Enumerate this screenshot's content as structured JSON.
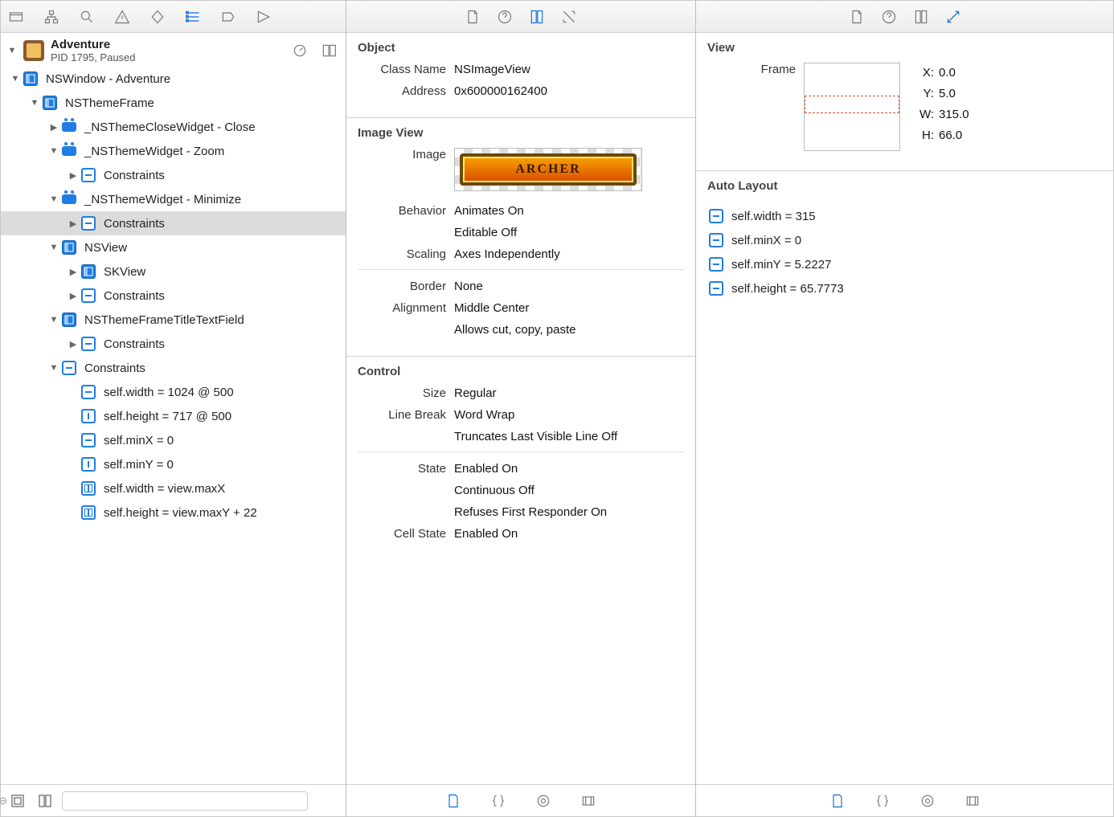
{
  "process": {
    "name": "Adventure",
    "subtitle": "PID 1795, Paused"
  },
  "tree": [
    {
      "indent": 0,
      "tri": "▼",
      "icon": "window",
      "label": "NSWindow - Adventure"
    },
    {
      "indent": 1,
      "tri": "▼",
      "icon": "view",
      "label": "NSThemeFrame"
    },
    {
      "indent": 2,
      "tri": "▶",
      "icon": "widget",
      "label": "_NSThemeCloseWidget - Close"
    },
    {
      "indent": 2,
      "tri": "▼",
      "icon": "widget",
      "label": "_NSThemeWidget - Zoom"
    },
    {
      "indent": 3,
      "tri": "▶",
      "icon": "constraint",
      "label": "Constraints"
    },
    {
      "indent": 2,
      "tri": "▼",
      "icon": "widget",
      "label": "_NSThemeWidget - Minimize"
    },
    {
      "indent": 3,
      "tri": "▶",
      "icon": "constraint",
      "label": "Constraints",
      "selected": true
    },
    {
      "indent": 2,
      "tri": "▼",
      "icon": "view",
      "label": "NSView"
    },
    {
      "indent": 3,
      "tri": "▶",
      "icon": "view",
      "label": "SKView"
    },
    {
      "indent": 3,
      "tri": "▶",
      "icon": "constraint",
      "label": "Constraints"
    },
    {
      "indent": 2,
      "tri": "▼",
      "icon": "view",
      "label": "NSThemeFrameTitleTextField"
    },
    {
      "indent": 3,
      "tri": "▶",
      "icon": "constraint",
      "label": "Constraints"
    },
    {
      "indent": 2,
      "tri": "▼",
      "icon": "constraint",
      "label": "Constraints"
    },
    {
      "indent": 3,
      "tri": "",
      "icon": "constraint-h",
      "label": "self.width = 1024 @ 500"
    },
    {
      "indent": 3,
      "tri": "",
      "icon": "constraint-v",
      "label": "self.height = 717 @ 500"
    },
    {
      "indent": 3,
      "tri": "",
      "icon": "constraint-h",
      "label": "self.minX = 0"
    },
    {
      "indent": 3,
      "tri": "",
      "icon": "constraint-v",
      "label": "self.minY = 0"
    },
    {
      "indent": 3,
      "tri": "",
      "icon": "constraint-rel",
      "label": "self.width = view.maxX"
    },
    {
      "indent": 3,
      "tri": "",
      "icon": "constraint-rel",
      "label": "self.height = view.maxY + 22"
    }
  ],
  "object": {
    "section": "Object",
    "class_label": "Class Name",
    "class_value": "NSImageView",
    "addr_label": "Address",
    "addr_value": "0x600000162400"
  },
  "imageview": {
    "section": "Image View",
    "image_label": "Image",
    "image_text": "Archer",
    "behavior_label": "Behavior",
    "behavior_v1": "Animates On",
    "behavior_v2": "Editable Off",
    "scaling_label": "Scaling",
    "scaling_value": "Axes Independently",
    "border_label": "Border",
    "border_value": "None",
    "align_label": "Alignment",
    "align_value": "Middle Center",
    "allows": "Allows cut, copy, paste"
  },
  "control": {
    "section": "Control",
    "size_label": "Size",
    "size_value": "Regular",
    "lb_label": "Line Break",
    "lb_value": "Word Wrap",
    "trunc": "Truncates Last Visible Line Off",
    "state_label": "State",
    "state_v1": "Enabled On",
    "state_v2": "Continuous Off",
    "state_v3": "Refuses First Responder On",
    "cellstate_label": "Cell State",
    "cellstate_value": "Enabled On"
  },
  "view": {
    "section": "View",
    "frame_label": "Frame",
    "x_label": "X:",
    "x": "0.0",
    "y_label": "Y:",
    "y": "5.0",
    "w_label": "W:",
    "w": "315.0",
    "h_label": "H:",
    "h": "66.0"
  },
  "autolayout": {
    "section": "Auto Layout",
    "items": [
      "self.width = 315",
      "self.minX = 0",
      "self.minY = 5.2227",
      "self.height = 65.7773"
    ]
  }
}
